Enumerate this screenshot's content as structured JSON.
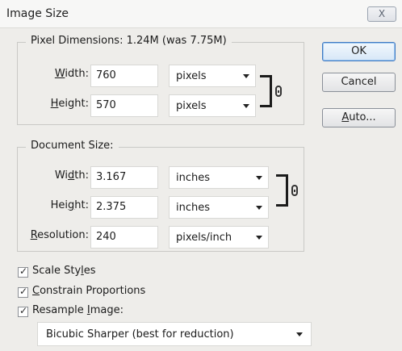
{
  "window": {
    "title": "Image Size",
    "close_label": "X"
  },
  "pixel_dimensions": {
    "legend": "Pixel Dimensions:  1.24M (was 7.75M)",
    "width": {
      "label_pre": "",
      "label_ul": "W",
      "label_post": "idth:",
      "value": "760",
      "unit": "pixels"
    },
    "height": {
      "label_pre": "",
      "label_ul": "H",
      "label_post": "eight:",
      "value": "570",
      "unit": "pixels"
    }
  },
  "document_size": {
    "legend": "Document Size:",
    "width": {
      "label_pre": "Wi",
      "label_ul": "d",
      "label_post": "th:",
      "value": "3.167",
      "unit": "inches"
    },
    "height": {
      "label_pre": "Hei",
      "label_ul": "g",
      "label_post": "ht:",
      "value": "2.375",
      "unit": "inches"
    },
    "resolution": {
      "label_pre": "",
      "label_ul": "R",
      "label_post": "esolution:",
      "value": "240",
      "unit": "pixels/inch"
    }
  },
  "options": {
    "scale_styles": {
      "pre": "Scale Sty",
      "ul": "l",
      "post": "es",
      "checked": true
    },
    "constrain": {
      "pre": "",
      "ul": "C",
      "post": "onstrain Proportions",
      "checked": true
    },
    "resample": {
      "pre": "Resample ",
      "ul": "I",
      "post": "mage:",
      "checked": true
    },
    "resample_method": "Bicubic Sharper (best for reduction)"
  },
  "buttons": {
    "ok": "OK",
    "cancel": "Cancel",
    "auto": {
      "ul": "A",
      "post": "uto..."
    }
  }
}
